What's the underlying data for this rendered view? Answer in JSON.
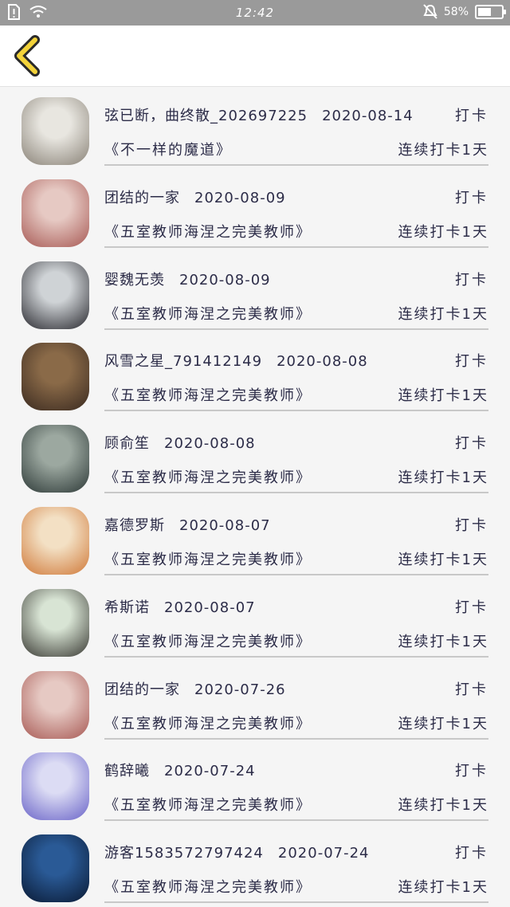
{
  "status_bar": {
    "time": "12:42",
    "battery": "58%",
    "battery_level": 0.58
  },
  "nav": {
    "back_icon": "chevron-left-icon"
  },
  "items": [
    {
      "user": "弦已断，曲终散_202697225",
      "date": "2020-08-14",
      "book": "《不一样的魔道》",
      "checkin": "打卡",
      "streak": "连续打卡1天",
      "avatar_colors": [
        "#e8e6e0",
        "#8a8378"
      ]
    },
    {
      "user": "团结的一家",
      "date": "2020-08-09",
      "book": "《五室教师海涅之完美教师》",
      "checkin": "打卡",
      "streak": "连续打卡1天",
      "avatar_colors": [
        "#e6c9c3",
        "#a85a55"
      ]
    },
    {
      "user": "婴魏无羡",
      "date": "2020-08-09",
      "book": "《五室教师海涅之完美教师》",
      "checkin": "打卡",
      "streak": "连续打卡1天",
      "avatar_colors": [
        "#cfd3d6",
        "#2a2a30"
      ]
    },
    {
      "user": "风雪之星_791412149",
      "date": "2020-08-08",
      "book": "《五室教师海涅之完美教师》",
      "checkin": "打卡",
      "streak": "连续打卡1天",
      "avatar_colors": [
        "#8a6a48",
        "#3a2a20"
      ]
    },
    {
      "user": "顾俞笙",
      "date": "2020-08-08",
      "book": "《五室教师海涅之完美教师》",
      "checkin": "打卡",
      "streak": "连续打卡1天",
      "avatar_colors": [
        "#9ca8a0",
        "#2e3a38"
      ]
    },
    {
      "user": "嘉德罗斯",
      "date": "2020-08-07",
      "book": "《五室教师海涅之完美教师》",
      "checkin": "打卡",
      "streak": "连续打卡1天",
      "avatar_colors": [
        "#f3e0c4",
        "#d07a3a"
      ]
    },
    {
      "user": "希斯诺",
      "date": "2020-08-07",
      "book": "《五室教师海涅之完美教师》",
      "checkin": "打卡",
      "streak": "连续打卡1天",
      "avatar_colors": [
        "#d8e4d4",
        "#3a3a34"
      ]
    },
    {
      "user": "团结的一家",
      "date": "2020-07-26",
      "book": "《五室教师海涅之完美教师》",
      "checkin": "打卡",
      "streak": "连续打卡1天",
      "avatar_colors": [
        "#e6c9c3",
        "#a85a55"
      ]
    },
    {
      "user": "鹤辞曦",
      "date": "2020-07-24",
      "book": "《五室教师海涅之完美教师》",
      "checkin": "打卡",
      "streak": "连续打卡1天",
      "avatar_colors": [
        "#dcdcf4",
        "#6a64c8"
      ]
    },
    {
      "user": "游客1583572797424",
      "date": "2020-07-24",
      "book": "《五室教师海涅之完美教师》",
      "checkin": "打卡",
      "streak": "连续打卡1天",
      "avatar_colors": [
        "#2a5a96",
        "#0a1a34"
      ]
    }
  ]
}
